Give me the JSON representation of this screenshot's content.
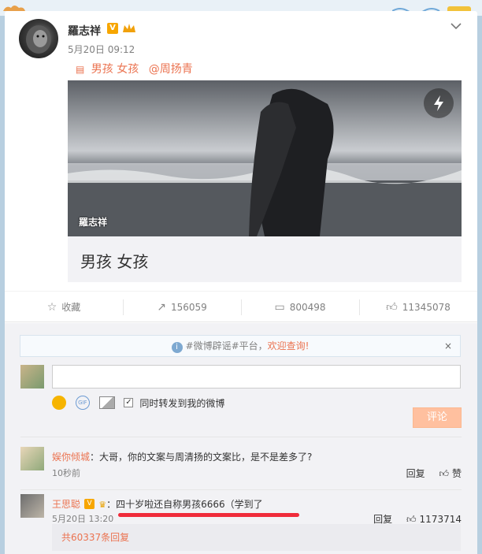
{
  "post": {
    "author": "羅志祥",
    "verified_badge": "V",
    "time": "5月20日 09:12",
    "topic_tag": "男孩 女孩",
    "mention": "@周扬青",
    "photo_watermark": "羅志祥",
    "caption": "男孩 女孩"
  },
  "actions": {
    "favorite": "收藏",
    "repost_count": "156059",
    "comment_count": "800498",
    "like_count": "11345078"
  },
  "notice": {
    "prefix": "#微博辟谣#平台，",
    "highlight": "欢迎查询!",
    "close": "×"
  },
  "composer": {
    "repost_label": "同时转发到我的微博",
    "submit_label": "评论",
    "gif_label": "GIF"
  },
  "comments": [
    {
      "name": "娱你倾城",
      "text": "：大哥，你的文案与周清扬的文案比，是不是差多了?",
      "time": "10秒前",
      "reply": "回复",
      "like": "赞"
    },
    {
      "name": "王思聪",
      "text": "：四十岁啦还自称男孩6666（学到了",
      "time": "5月20日 13:20",
      "reply": "回复",
      "like": "1173714",
      "badge": "V"
    }
  ],
  "more_replies": "共60337条回复",
  "colors": {
    "accent": "#eb7350",
    "background": "#b8cfe0",
    "verified": "#f7a600",
    "highlight_line": "#f02b3a"
  }
}
